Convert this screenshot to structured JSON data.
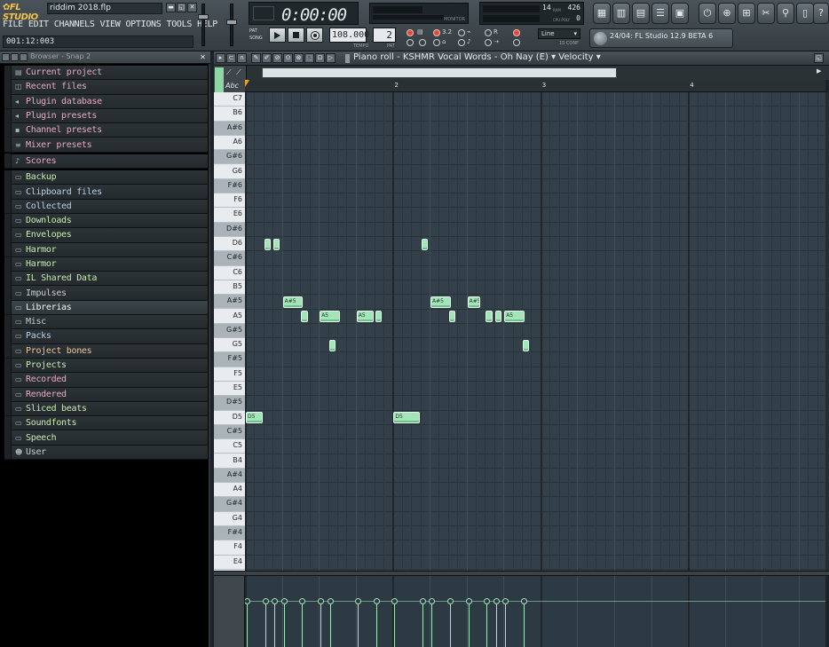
{
  "window": {
    "app_name": "FL STUDIO",
    "project_file": "riddim 2018.flp"
  },
  "menu": [
    "FILE",
    "EDIT",
    "CHANNELS",
    "VIEW",
    "OPTIONS",
    "TOOLS",
    "HELP"
  ],
  "hint_bar": "001:12:003",
  "transport": {
    "time": "0:00:00",
    "tempo": "108.000",
    "tempo_label": "TEMPO",
    "pattern": "2",
    "pattern_label": "PAT",
    "pat_label": "PAT",
    "song_label": "SONG",
    "monitor_label": "MONITOR"
  },
  "cpu": {
    "a": "14",
    "b": "426",
    "c": "0",
    "label_a": "RAM",
    "label_b": "CPU POLY"
  },
  "snap": {
    "value": "Line",
    "caption": "1S CONF"
  },
  "news": "24/04: FL Studio 12.9 BETA 6",
  "browser": {
    "title": "Browser - Snap 2",
    "items": [
      {
        "label": "Current project",
        "icon": "page-icon",
        "glyph": "▤",
        "color": "pink"
      },
      {
        "label": "Recent files",
        "icon": "folder-recent-icon",
        "glyph": "◫",
        "color": "pink"
      },
      {
        "label": "Plugin database",
        "icon": "plugin-icon",
        "glyph": "◂",
        "color": "pink"
      },
      {
        "label": "Plugin presets",
        "icon": "plugin-icon",
        "glyph": "◂",
        "color": "pink"
      },
      {
        "label": "Channel presets",
        "icon": "channel-icon",
        "glyph": "▪",
        "color": "pink"
      },
      {
        "label": "Mixer presets",
        "icon": "mixer-icon",
        "glyph": "≡",
        "color": "pink"
      },
      {
        "label": "Scores",
        "icon": "score-icon",
        "glyph": "♪",
        "color": "pink"
      },
      {
        "label": "Backup",
        "icon": "folder-icon",
        "glyph": "▭",
        "color": "green"
      },
      {
        "label": "Clipboard files",
        "icon": "folder-icon",
        "glyph": "▭",
        "color": "blue"
      },
      {
        "label": "Collected",
        "icon": "folder-icon",
        "glyph": "▭",
        "color": "blue"
      },
      {
        "label": "Downloads",
        "icon": "folder-icon",
        "glyph": "▭",
        "color": "green"
      },
      {
        "label": "Envelopes",
        "icon": "folder-icon",
        "glyph": "▭",
        "color": "green"
      },
      {
        "label": "Harmor",
        "icon": "folder-icon",
        "glyph": "▭",
        "color": "green"
      },
      {
        "label": "Harmor",
        "icon": "folder-icon",
        "glyph": "▭",
        "color": "green"
      },
      {
        "label": "IL Shared Data",
        "icon": "folder-icon",
        "glyph": "▭",
        "color": "green"
      },
      {
        "label": "Impulses",
        "icon": "folder-icon",
        "glyph": "▭",
        "color": "gray"
      },
      {
        "label": "Librerias",
        "icon": "folder-icon",
        "glyph": "▭",
        "color": "gray"
      },
      {
        "label": "Misc",
        "icon": "folder-icon",
        "glyph": "▭",
        "color": "gray"
      },
      {
        "label": "Packs",
        "icon": "folder-icon",
        "glyph": "▭",
        "color": "blue"
      },
      {
        "label": "Project bones",
        "icon": "folder-icon",
        "glyph": "▭",
        "color": "orange"
      },
      {
        "label": "Projects",
        "icon": "folder-icon",
        "glyph": "▭",
        "color": "green"
      },
      {
        "label": "Recorded",
        "icon": "folder-icon",
        "glyph": "▭",
        "color": "pink"
      },
      {
        "label": "Rendered",
        "icon": "folder-icon",
        "glyph": "▭",
        "color": "pink"
      },
      {
        "label": "Sliced beats",
        "icon": "folder-icon",
        "glyph": "▭",
        "color": "green"
      },
      {
        "label": "Soundfonts",
        "icon": "folder-icon",
        "glyph": "▭",
        "color": "green"
      },
      {
        "label": "Speech",
        "icon": "folder-icon",
        "glyph": "▭",
        "color": "green"
      },
      {
        "label": "User",
        "icon": "user-icon",
        "glyph": "☻",
        "color": "gray"
      }
    ],
    "selected": "Librerias"
  },
  "piano_roll": {
    "title": "Piano roll - KSHMR Vocal Words - Oh Nay (E) ▾ Velocity ▾",
    "key_label_abc": "Abc",
    "bar_numbers": [
      "2",
      "3",
      "4"
    ],
    "keys": [
      "C7",
      "B6",
      "A#6",
      "A6",
      "G#6",
      "G6",
      "F#6",
      "F6",
      "E6",
      "D#6",
      "D6",
      "C#6",
      "C6",
      "B5",
      "A#5",
      "A5",
      "G#5",
      "G5",
      "F#5",
      "F5",
      "E5",
      "D#5",
      "D5",
      "C#5",
      "C5",
      "B4",
      "A#4",
      "A4",
      "G#4",
      "G4",
      "F#4",
      "F4",
      "E4"
    ],
    "notes": [
      {
        "pitch": "D6",
        "start": 1.0,
        "len": 0.35,
        "label": ""
      },
      {
        "pitch": "D6",
        "start": 1.5,
        "len": 0.35,
        "label": ""
      },
      {
        "pitch": "A#5",
        "start": 2.0,
        "len": 1.1,
        "label": "A#5"
      },
      {
        "pitch": "A5",
        "start": 3.0,
        "len": 0.35,
        "label": ""
      },
      {
        "pitch": "A5",
        "start": 4.0,
        "len": 1.1,
        "label": "A5"
      },
      {
        "pitch": "G5",
        "start": 4.5,
        "len": 0.35,
        "label": ""
      },
      {
        "pitch": "A5",
        "start": 6.0,
        "len": 0.9,
        "label": "A5"
      },
      {
        "pitch": "A5",
        "start": 7.0,
        "len": 0.35,
        "label": ""
      },
      {
        "pitch": "D5",
        "start": 0.0,
        "len": 0.9,
        "label": "D5"
      },
      {
        "pitch": "D5",
        "start": 8.0,
        "len": 1.4,
        "label": "D5"
      },
      {
        "pitch": "D6",
        "start": 9.5,
        "len": 0.35,
        "label": ""
      },
      {
        "pitch": "A#5",
        "start": 10.0,
        "len": 1.1,
        "label": "A#5"
      },
      {
        "pitch": "A5",
        "start": 11.0,
        "len": 0.35,
        "label": ""
      },
      {
        "pitch": "A#5",
        "start": 12.0,
        "len": 0.7,
        "label": "A#5"
      },
      {
        "pitch": "A5",
        "start": 13.0,
        "len": 0.35,
        "label": ""
      },
      {
        "pitch": "A5",
        "start": 13.5,
        "len": 0.35,
        "label": ""
      },
      {
        "pitch": "A5",
        "start": 14.0,
        "len": 1.1,
        "label": "A5"
      },
      {
        "pitch": "G5",
        "start": 15.0,
        "len": 0.35,
        "label": ""
      }
    ]
  },
  "colors": {
    "note": "#a3e5b9",
    "grid": "#33404a",
    "accent": "#f0a020"
  }
}
